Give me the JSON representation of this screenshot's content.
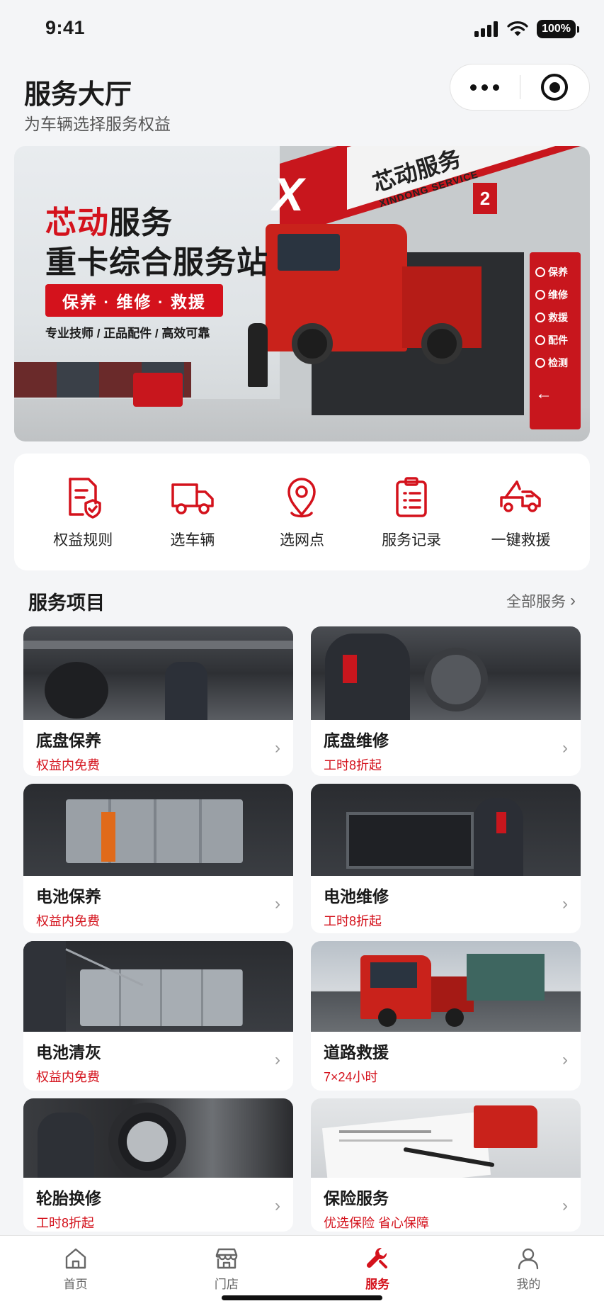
{
  "status_bar": {
    "time": "9:41",
    "battery": "100%"
  },
  "header": {
    "title": "服务大厅",
    "subtitle": "为车辆选择服务权益"
  },
  "banner": {
    "brand_highlight": "芯动",
    "brand_rest": "服务",
    "headline": "重卡综合服务站",
    "pill": "保养 · 维修 · 救援",
    "tagline": "专业技师 / 正品配件 / 高效可靠",
    "sign_text": "芯动服务",
    "sign_subtext": "XINDONG SERVICE",
    "bay_number": "2",
    "pylon_items": [
      "保养",
      "维修",
      "救援",
      "配件",
      "检测"
    ]
  },
  "quick_actions": [
    {
      "label": "权益规则",
      "icon": "policy-shield-icon"
    },
    {
      "label": "选车辆",
      "icon": "truck-icon"
    },
    {
      "label": "选网点",
      "icon": "location-pin-icon"
    },
    {
      "label": "服务记录",
      "icon": "clipboard-list-icon"
    },
    {
      "label": "一键救援",
      "icon": "tow-truck-icon"
    }
  ],
  "services_section": {
    "title": "服务项目",
    "more": "全部服务"
  },
  "services": [
    {
      "title": "底盘保养",
      "subtitle": "权益内免费"
    },
    {
      "title": "底盘维修",
      "subtitle": "工时8折起"
    },
    {
      "title": "电池保养",
      "subtitle": "权益内免费"
    },
    {
      "title": "电池维修",
      "subtitle": "工时8折起"
    },
    {
      "title": "电池清灰",
      "subtitle": "权益内免费"
    },
    {
      "title": "道路救援",
      "subtitle": "7×24小时"
    },
    {
      "title": "轮胎换修",
      "subtitle": "工时8折起"
    },
    {
      "title": "保险服务",
      "subtitle": "优选保险  省心保障"
    }
  ],
  "tabbar": [
    {
      "label": "首页",
      "icon": "home-icon"
    },
    {
      "label": "门店",
      "icon": "store-icon"
    },
    {
      "label": "服务",
      "icon": "wrench-icon",
      "active": true
    },
    {
      "label": "我的",
      "icon": "user-icon"
    }
  ],
  "colors": {
    "accent": "#d4121c",
    "background": "#f4f5f7"
  }
}
